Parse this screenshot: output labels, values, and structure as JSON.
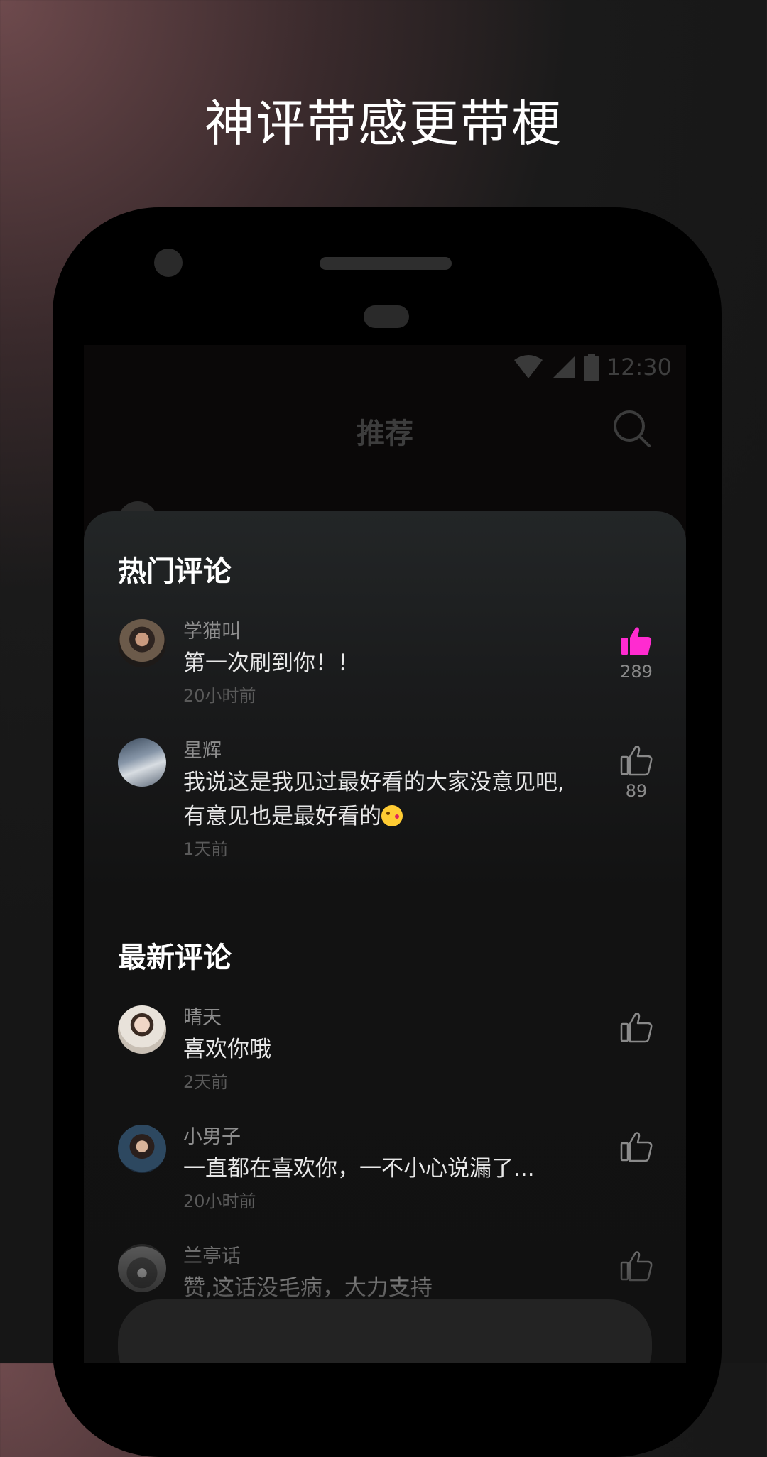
{
  "promo": {
    "headline": "神评带感更带梗"
  },
  "status_bar": {
    "time": "12:30"
  },
  "app_bar": {
    "title": "推荐"
  },
  "hot_comments": {
    "title": "热门评论",
    "items": [
      {
        "user": "学猫叫",
        "text": "第一次刷到你！！",
        "time": "20小时前",
        "likes": "289",
        "liked": true,
        "like_color": "#ff2bd0"
      },
      {
        "user": "星辉",
        "text": "我说这是我见过最好看的大家没意见吧,",
        "text2": "有意见也是最好看的",
        "time": "1天前",
        "likes": "89",
        "liked": false
      }
    ]
  },
  "latest_comments": {
    "title": "最新评论",
    "items": [
      {
        "user": "晴天",
        "text": "喜欢你哦",
        "time": "2天前"
      },
      {
        "user": "小男子",
        "text": "一直都在喜欢你，一不小心说漏了...",
        "time": "20小时前"
      },
      {
        "user": "兰亭话",
        "text": "赞,这话没毛病，大力支持"
      }
    ]
  },
  "colors": {
    "accent_like": "#ff2bd0",
    "background": "#161616",
    "sheet": "#121212"
  },
  "icons": [
    "wifi-icon",
    "signal-icon",
    "battery-icon",
    "search-icon",
    "thumbs-up-icon"
  ]
}
